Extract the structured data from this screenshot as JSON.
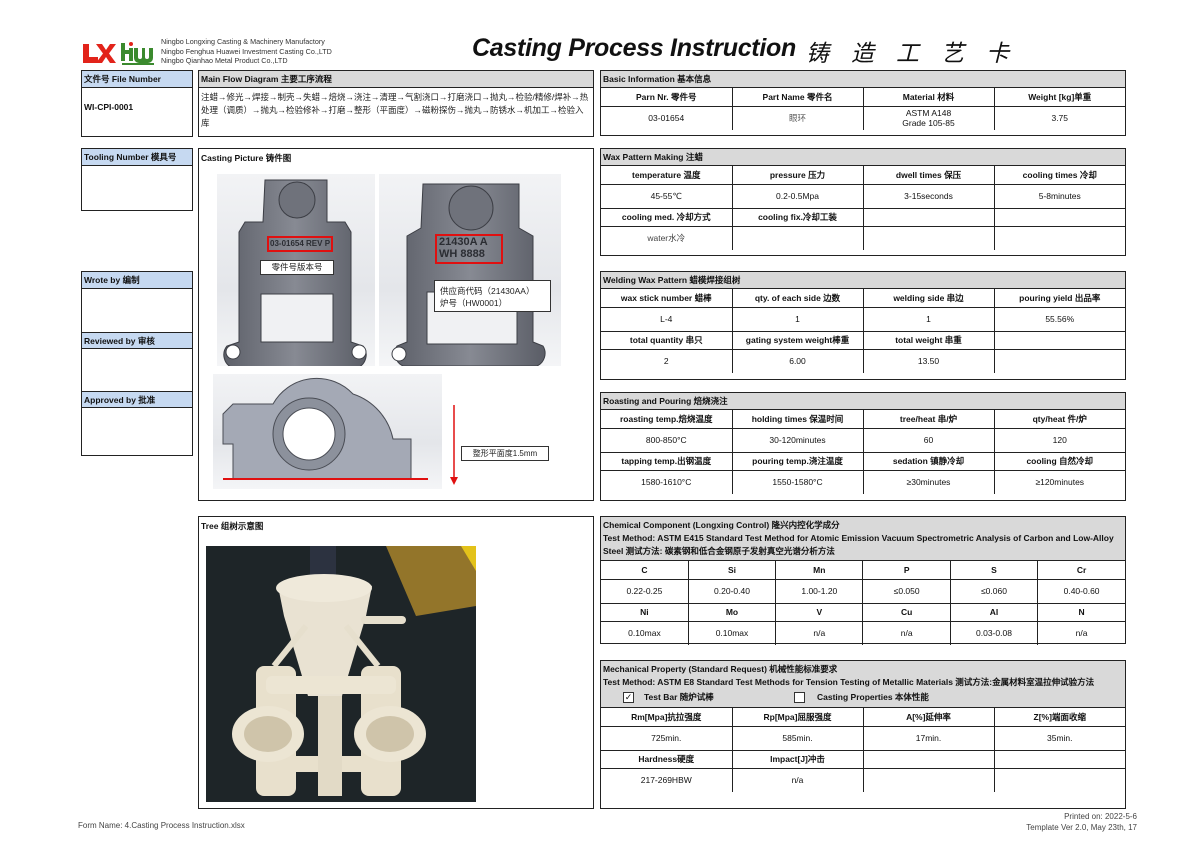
{
  "header": {
    "companies": [
      "Ningbo Longxing Casting & Machinery Manufactory",
      "Ningbo Fenghua Huawei Investment Casting Co.,LTD",
      "Ningbo Qianhao Metal Product Co.,LTD"
    ],
    "logo_lx_icon": "lx-logo",
    "logo_hw_icon": "hw-logo",
    "colors": {
      "lx_red": "#e2231a",
      "hw_green": "#3b8a2e"
    },
    "title": "Casting Process Instruction",
    "title_cn": "铸造工艺卡"
  },
  "file_number": {
    "label": "文件号 File Number",
    "value": "WI-CPI-0001"
  },
  "tooling_number": {
    "label": "Tooling Number 模具号",
    "value": ""
  },
  "wrote_by": {
    "label": "Wrote by 编制",
    "value": ""
  },
  "reviewed_by": {
    "label": "Reviewed by 审核",
    "value": ""
  },
  "approved_by": {
    "label": "Approved by 批准",
    "value": ""
  },
  "main_flow": {
    "label": "Main Flow Diagram 主要工序流程",
    "text": "注蜡→修光→焊接→制壳→失蜡→焙烧→浇注→清理→气割浇口→打磨浇口→抛丸→检验/精修/焊补→热处理（调质）→抛丸→检验修补→打磨→整形（平面度）→磁粉探伤→抛丸→防锈水→机加工→检验入库"
  },
  "casting_picture": {
    "label": "Casting Picture 铸件图",
    "part_mark": "03-01654 REV P",
    "part_mark_callout": "零件号版本号",
    "supplier_mark_line1": "21430A A",
    "supplier_mark_line2": "WH 8888",
    "supplier_callout_line1": "供应商代码（21430AA）",
    "supplier_callout_line2": "炉号（HW0001）",
    "flatness_callout": "整形平面度1.5mm"
  },
  "tree": {
    "label": "Tree 组树示意图"
  },
  "basic_info": {
    "title": "Basic Information 基本信息",
    "headers": [
      "Parn Nr. 零件号",
      "Part Name 零件名",
      "Material 材料",
      "Weight [kg]单重"
    ],
    "values": [
      "03-01654",
      "眼环",
      "ASTM A148",
      "3.75"
    ],
    "material_line2": "Grade 105-85"
  },
  "wax_pattern": {
    "title": "Wax Pattern Making 注蜡",
    "row1_headers": [
      "temperature 温度",
      "pressure 压力",
      "dwell times 保压",
      "cooling times 冷却"
    ],
    "row1_values": [
      "45-55℃",
      "0.2-0.5Mpa",
      "3-15seconds",
      "5-8minutes"
    ],
    "row2_headers": [
      "cooling med. 冷却方式",
      "cooling fix.冷却工装",
      "",
      ""
    ],
    "row2_values": [
      "water水冷",
      "",
      "",
      ""
    ]
  },
  "welding": {
    "title": "Welding Wax Pattern 蜡模焊接组树",
    "row1_headers": [
      "wax stick number 蜡棒",
      "qty. of each side 边数",
      "welding side 串边",
      "pouring yield 出品率"
    ],
    "row1_values": [
      "L-4",
      "1",
      "1",
      "55.56%"
    ],
    "row2_headers": [
      "total quantity 串只",
      "gating system weight棒重",
      "total weight 串重",
      ""
    ],
    "row2_values": [
      "2",
      "6.00",
      "13.50",
      ""
    ]
  },
  "roasting": {
    "title": "Roasting and Pouring 焙烧浇注",
    "row1_headers": [
      "roasting temp.焙烧温度",
      "holding times 保温时间",
      "tree/heat 串/炉",
      "qty/heat 件/炉"
    ],
    "row1_values": [
      "800-850°C",
      "30-120minutes",
      "60",
      "120"
    ],
    "row2_headers": [
      "tapping temp.出钢温度",
      "pouring temp.浇注温度",
      "sedation 镇静冷却",
      "cooling 自然冷却"
    ],
    "row2_values": [
      "1580-1610°C",
      "1550-1580°C",
      "≥30minutes",
      "≥120minutes"
    ]
  },
  "chemical": {
    "title": "Chemical Component (Longxing Control) 隆兴内控化学成分",
    "method": "Test Method: ASTM E415 Standard Test Method for Atomic Emission Vacuum Spectrometric Analysis of Carbon and Low-Alloy Steel 测试方法: 碳素钢和低合金钢原子发射真空光谱分析方法",
    "row1_headers": [
      "C",
      "Si",
      "Mn",
      "P",
      "S",
      "Cr"
    ],
    "row1_values": [
      "0.22-0.25",
      "0.20-0.40",
      "1.00-1.20",
      "≤0.050",
      "≤0.060",
      "0.40-0.60"
    ],
    "row2_headers": [
      "Ni",
      "Mo",
      "V",
      "Cu",
      "Al",
      "N"
    ],
    "row2_values": [
      "0.10max",
      "0.10max",
      "n/a",
      "n/a",
      "0.03-0.08",
      "n/a"
    ]
  },
  "mechanical": {
    "title": "Mechanical Property (Standard Request) 机械性能标准要求",
    "method": "Test Method: ASTM E8 Standard Test Methods for Tension Testing of Metallic Materials 测试方法:金属材料室温拉伸试验方法",
    "test_bar": {
      "label": "Test Bar 随炉试棒",
      "checked": true,
      "mark": "✓"
    },
    "casting_properties": {
      "label": "Casting Properties 本体性能",
      "checked": false,
      "mark": ""
    },
    "row1_headers": [
      "Rm[Mpa]抗拉强度",
      "Rp[Mpa]屈服强度",
      "A[%]延伸率",
      "Z[%]端面收缩"
    ],
    "row1_values": [
      "725min.",
      "585min.",
      "17min.",
      "35min."
    ],
    "row2_headers": [
      "Hardness硬度",
      "Impact[J]冲击",
      "",
      ""
    ],
    "row2_values": [
      "217-269HBW",
      "n/a",
      "",
      ""
    ]
  },
  "footer": {
    "form_name": "Form Name: 4.Casting Process Instruction.xlsx",
    "printed_on": "Printed on: 2022-5-6",
    "template_ver": "Template Ver 2.0, May 23th, 17"
  }
}
